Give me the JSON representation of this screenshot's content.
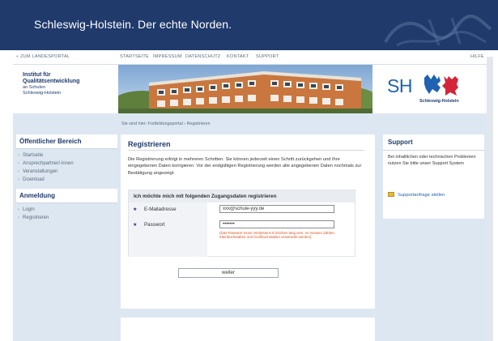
{
  "banner": {
    "tagline": "Schleswig-Holstein. Der echte Norden."
  },
  "nav": {
    "portal_link": "« ZUM LANDESPORTAL",
    "items": [
      "STARTSEITE",
      "IMPRESSUM",
      "DATENSCHUTZ",
      "KONTAKT",
      "SUPPORT"
    ],
    "help": "HILFE"
  },
  "institute": {
    "line1": "Institut für",
    "line2": "Qualitätsentwicklung",
    "line3": "an Schulen",
    "line4": "Schleswig-Holstein"
  },
  "logo": {
    "sh": "SH",
    "word": "Schleswig-Holstein"
  },
  "breadcrumb": "Sie sind hier: Fortbildungsportal › Registrieren",
  "sidebar": {
    "public_title": "Öffentlicher Bereich",
    "public_items": [
      "Startseite",
      "Ansprechpartner/-innen",
      "Veranstaltungen",
      "Download"
    ],
    "login_title": "Anmeldung",
    "login_items": [
      "Login",
      "Registrieren"
    ]
  },
  "main": {
    "title": "Registrieren",
    "intro": "Die Registrierung erfolgt in mehreren Schritten. Sie können jederzeit einen Schritt zurückgehen und Ihre eingegebenen Daten korrigieren. Vor der endgültigen Registrierung werden alle angegebenen Daten nochmals zur Bestätigung angezeigt.",
    "form_title": "Ich möchte mich mit folgenden Zugangsdaten registrieren",
    "email_label": "E-Mailadresse",
    "email_value": "xxx@schule-yyy.de",
    "password_label": "Passwort",
    "password_value": "•••••••",
    "password_hint": "(Das Passwort muss mindestens 8 Zeichen lang sein, es müssen Zahlen, Kleinbuchstaben und Großbuchstaben verwendet werden)",
    "submit_label": "weiter"
  },
  "support": {
    "title": "Support",
    "text": "Bei inhaltlichen oder technischen Problemen nutzen Sie bitte unser Support System",
    "link": "Supportanfrage stellen"
  },
  "colors": {
    "banner": "#1f3a6b",
    "page_bg": "#dde7f2",
    "link": "#1e62b1",
    "hint": "#d9531e"
  }
}
